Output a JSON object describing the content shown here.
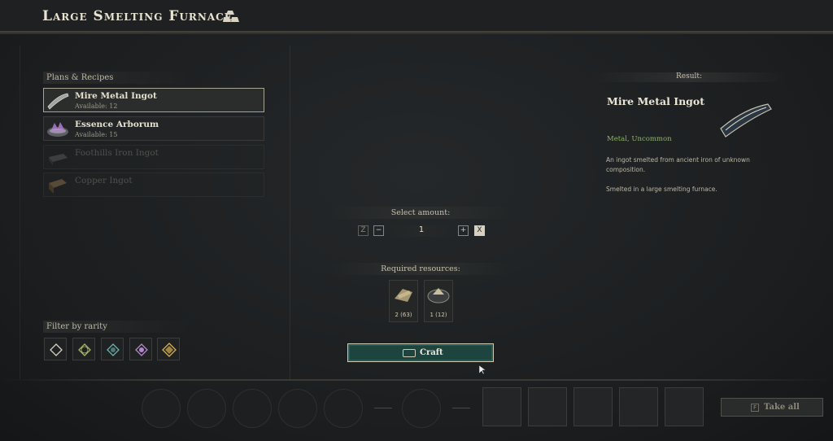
{
  "header": {
    "title": "Large Smelting Furnace",
    "title_icon": "ingot-stack-icon"
  },
  "recipes": {
    "label": "Plans & Recipes",
    "items": [
      {
        "name": "Mire Metal Ingot",
        "available": "Available: 12",
        "state": "selected",
        "icon": "mire-ingot-icon"
      },
      {
        "name": "Essence Arborum",
        "available": "Available: 15",
        "state": "enabled",
        "icon": "essence-arborum-icon"
      },
      {
        "name": "Foothills Iron Ingot",
        "available": "",
        "state": "disabled",
        "icon": "iron-ingot-icon"
      },
      {
        "name": "Copper Ingot",
        "available": "",
        "state": "disabled",
        "icon": "copper-ingot-icon"
      }
    ]
  },
  "filter": {
    "label": "Filter by rarity",
    "rarities": [
      {
        "name": "common",
        "color": "#d8d2c0"
      },
      {
        "name": "uncommon",
        "color": "#a7b86a"
      },
      {
        "name": "rare",
        "color": "#6fb3b0"
      },
      {
        "name": "epic",
        "color": "#b08acb"
      },
      {
        "name": "legendary",
        "color": "#d9b24e"
      }
    ]
  },
  "amount": {
    "label": "Select amount:",
    "value": "1",
    "min_key": "Z",
    "max_key": "X"
  },
  "resources": {
    "label": "Required resources:",
    "items": [
      {
        "count": "2",
        "owned": "(63)",
        "icon": "metal-scrap-icon"
      },
      {
        "count": "1",
        "owned": "(12)",
        "icon": "ore-bowl-icon"
      }
    ]
  },
  "craft": {
    "label": "Craft",
    "key_icon": "keyboard-key-icon"
  },
  "result": {
    "label": "Result:",
    "name": "Mire Metal Ingot",
    "type": "Metal, Uncommon",
    "description": "An ingot smelted from ancient iron of unknown composition.",
    "note": "Smelted in a large smelting furnace."
  },
  "bottom": {
    "take_all": "Take all",
    "take_all_key": "F"
  }
}
